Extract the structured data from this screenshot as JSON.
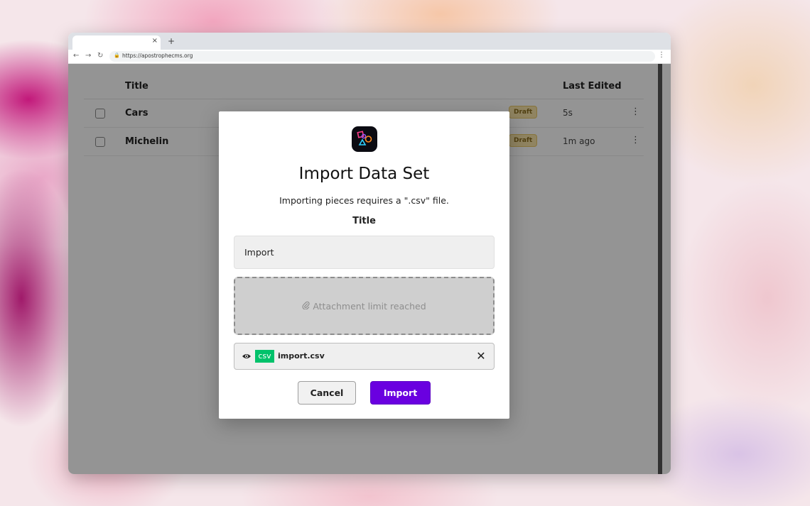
{
  "browser": {
    "url": "https://apostrophecms.org",
    "new_tab_glyph": "+",
    "close_glyph": "×"
  },
  "table": {
    "columns": {
      "title": "Title",
      "last_edited": "Last Edited"
    },
    "rows": [
      {
        "title": "Cars",
        "status": "Draft",
        "last_edited": "5s"
      },
      {
        "title": "Michelin",
        "status": "Draft",
        "last_edited": "1m ago"
      }
    ]
  },
  "modal": {
    "title": "Import Data Set",
    "description": "Importing pieces requires a \".csv\" file.",
    "field_label": "Title",
    "title_value": "Import",
    "dropzone_text": "Attachment limit reached",
    "file": {
      "type_badge": "csv",
      "name": "import.csv"
    },
    "cancel_label": "Cancel",
    "import_label": "Import"
  },
  "colors": {
    "accent": "#6a00e0",
    "csv_badge": "#00c26b",
    "draft_badge_bg": "#f9e4a8"
  },
  "icons": {
    "app_logo": "apostrophe-logo-icon",
    "eye": "eye-icon",
    "paperclip": "paperclip-icon",
    "remove": "close-icon",
    "row_menu": "kebab-menu-icon"
  }
}
